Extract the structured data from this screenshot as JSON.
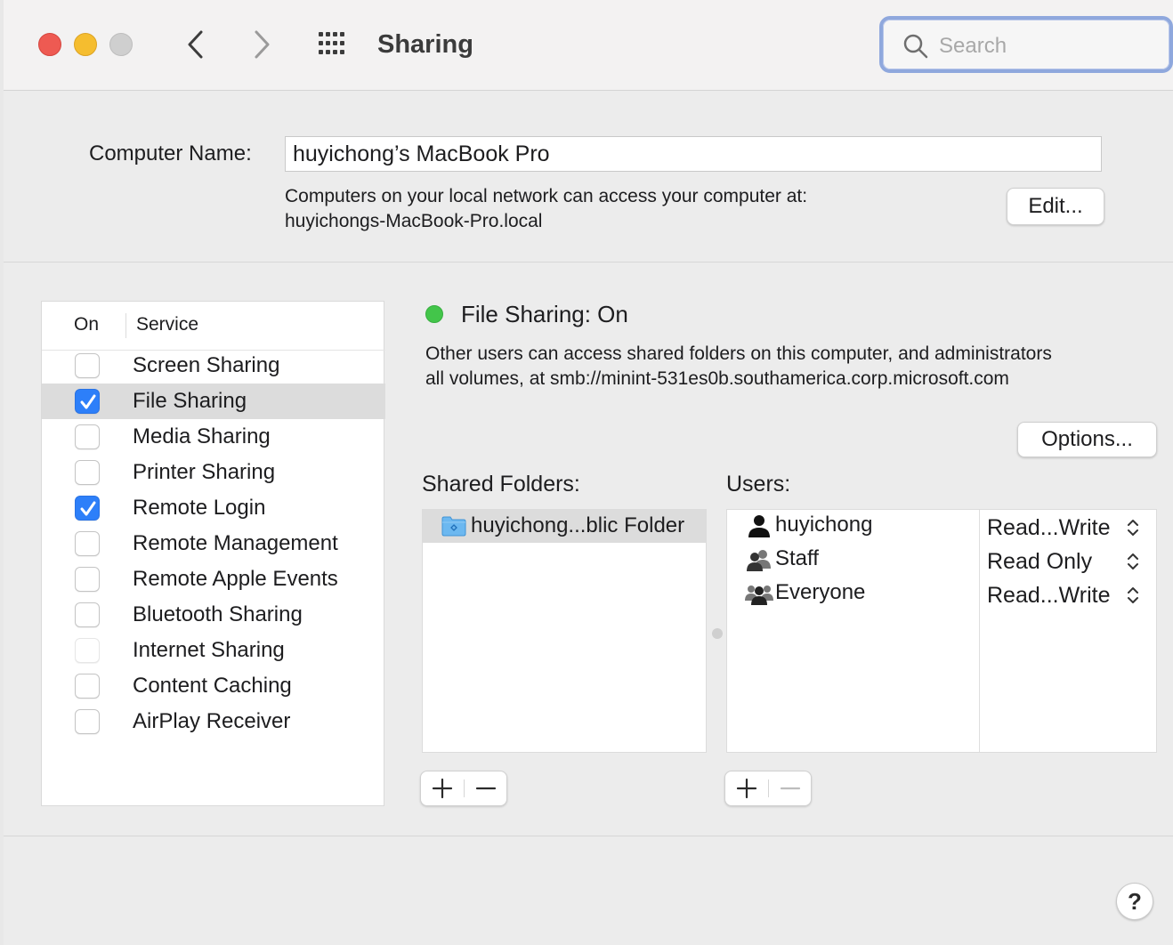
{
  "window": {
    "title": "Sharing"
  },
  "search": {
    "placeholder": "Search"
  },
  "computer_name": {
    "label": "Computer Name:",
    "value": "huyichong’s MacBook Pro",
    "local_line1": "Computers on your local network can access your computer at:",
    "local_line2": "huyichongs-MacBook-Pro.local",
    "edit_label": "Edit..."
  },
  "services": {
    "header_on": "On",
    "header_service": "Service",
    "items": [
      {
        "label": "Screen Sharing",
        "checked": false
      },
      {
        "label": "File Sharing",
        "checked": true,
        "selected": true
      },
      {
        "label": "Media Sharing",
        "checked": false
      },
      {
        "label": "Printer Sharing",
        "checked": false
      },
      {
        "label": "Remote Login",
        "checked": true
      },
      {
        "label": "Remote Management",
        "checked": false
      },
      {
        "label": "Remote Apple Events",
        "checked": false
      },
      {
        "label": "Bluetooth Sharing",
        "checked": false
      },
      {
        "label": "Internet Sharing",
        "checked": false,
        "disabled": true
      },
      {
        "label": "Content Caching",
        "checked": false
      },
      {
        "label": "AirPlay Receiver",
        "checked": false
      }
    ]
  },
  "detail": {
    "status": "File Sharing: On",
    "status_color": "#43c54a",
    "desc_line1": "Other users can access shared folders on this computer, and administrators",
    "desc_line2": "all volumes, at smb://minint-531es0b.southamerica.corp.microsoft.com",
    "options_label": "Options...",
    "shared_folders_label": "Shared Folders:",
    "users_label": "Users:",
    "shared_folders": [
      {
        "name": "huyichong...blic Folder",
        "icon": "folder-icon"
      }
    ],
    "users": [
      {
        "name": "huyichong",
        "icon": "person-icon",
        "permission": "Read...Write"
      },
      {
        "name": "Staff",
        "icon": "group-icon",
        "permission": "Read Only"
      },
      {
        "name": "Everyone",
        "icon": "group-everyone-icon",
        "permission": "Read...Write"
      }
    ]
  },
  "help_label": "?"
}
